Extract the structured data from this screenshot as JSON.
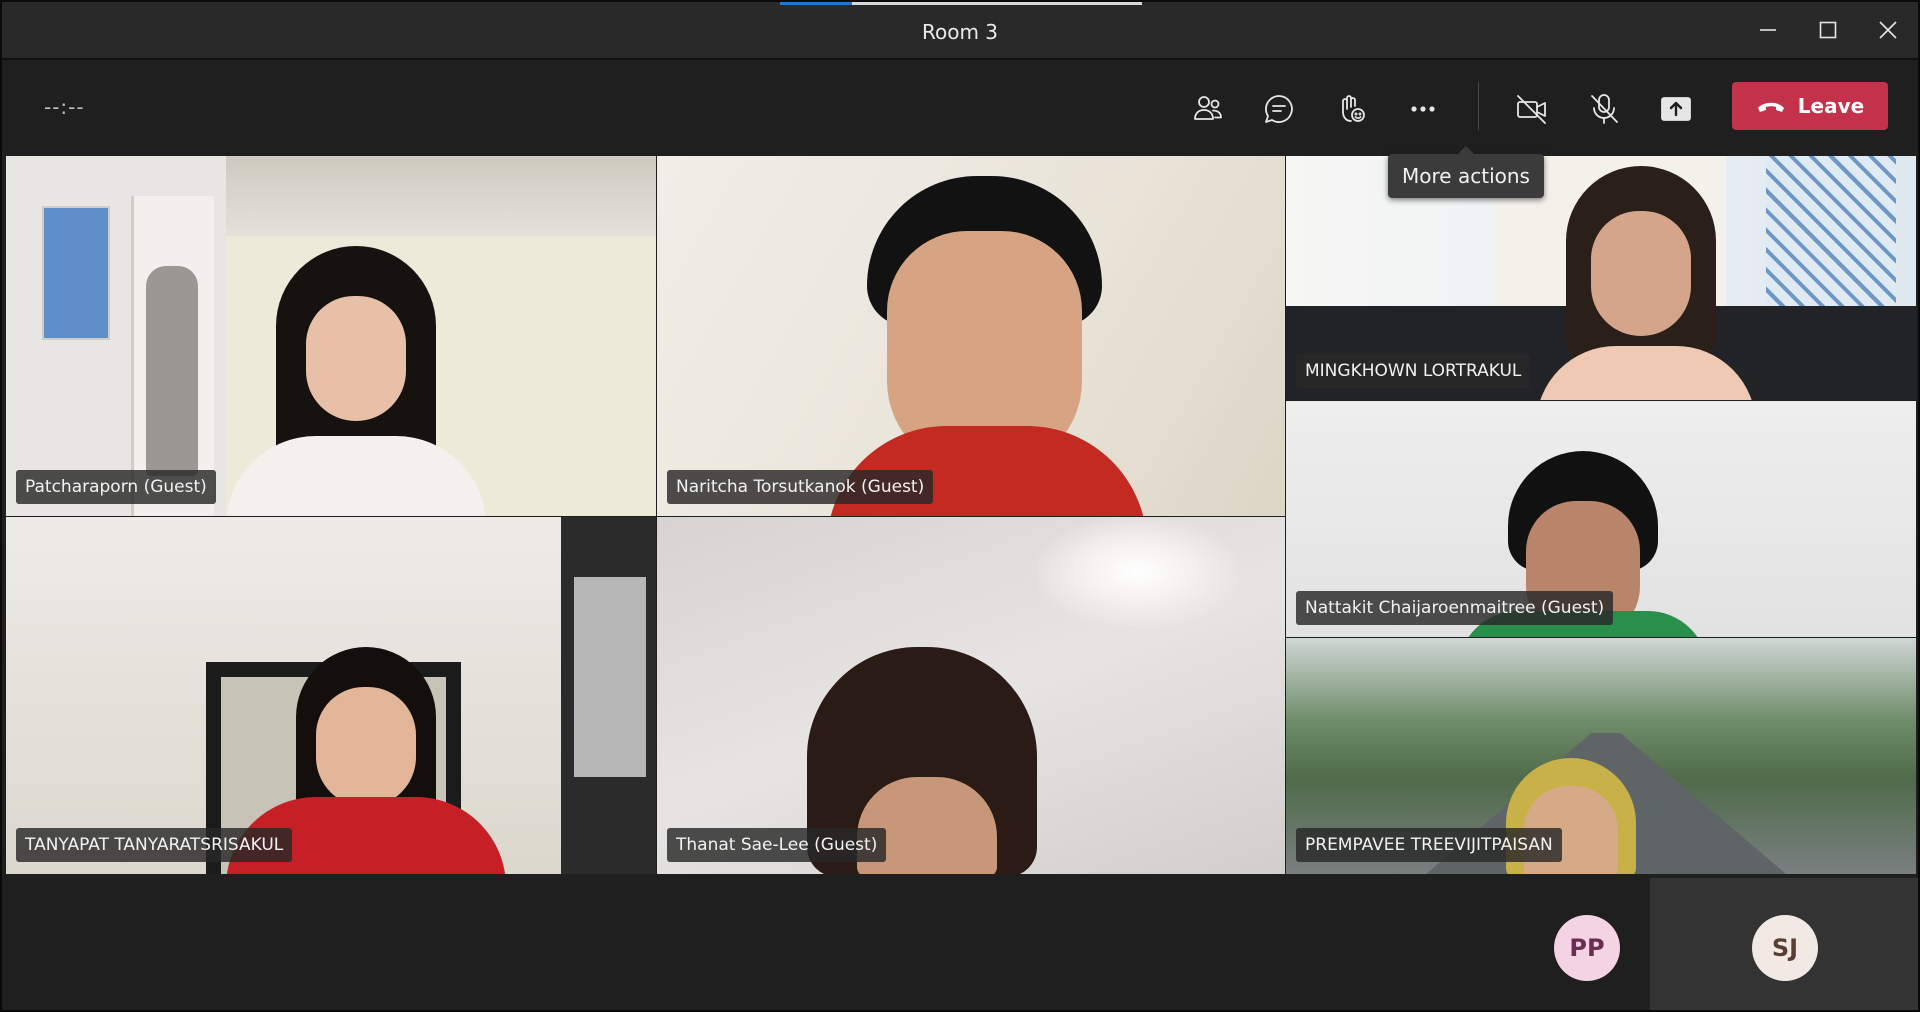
{
  "window": {
    "title": "Room 3"
  },
  "toolbar": {
    "timer": "--:--",
    "leave_label": "Leave",
    "tooltip": "More actions",
    "icons": [
      "people-icon",
      "chat-icon",
      "reactions-icon",
      "more-actions-icon",
      "camera-off-icon",
      "mic-off-icon",
      "share-screen-icon",
      "phone-hangup-icon"
    ]
  },
  "participants": [
    {
      "name": "Patcharaporn (Guest)"
    },
    {
      "name": "Naritcha Torsutkanok (Guest)"
    },
    {
      "name": "MINGKHOWN LORTRAKUL"
    },
    {
      "name": "Nattakit Chaijaroenmaitree (Guest)"
    },
    {
      "name": "TANYAPAT TANYARATSRISAKUL"
    },
    {
      "name": "Thanat Sae-Lee (Guest)"
    },
    {
      "name": "PREMPAVEE TREEVIJITPAISAN"
    }
  ],
  "avatars": [
    {
      "initials": "PP",
      "bg": "#f3d3e4",
      "fg": "#6b2e52"
    },
    {
      "initials": "SJ",
      "bg": "#f2e8e4",
      "fg": "#5a3d34"
    }
  ],
  "colors": {
    "leave": "#c4314b",
    "accent": "#1e77d2",
    "titlebar": "#292929",
    "toolbar": "#1f1f1f"
  }
}
